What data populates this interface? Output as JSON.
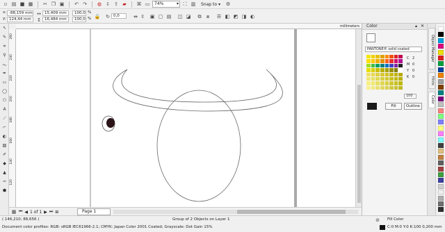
{
  "toolbar": {
    "zoom_value": "74%",
    "snap_label": "Snap to",
    "rotation_value": "0,0"
  },
  "propertybar": {
    "x_label": "x:",
    "x_value": "-88,159 mm",
    "y_label": "y:",
    "y_value": "124,44 mm",
    "width_value": "15,409 mm",
    "height_value": "16,484 mm",
    "scale_w": "100,0",
    "scale_h": "100,0",
    "scale_unit": "%"
  },
  "ruler": {
    "unit_label": "millimeters",
    "v_ticks": [
      "260",
      "240",
      "220",
      "200",
      "180",
      "160",
      "140",
      "120"
    ]
  },
  "page_nav": {
    "page_count": "1 of 1",
    "page_tab": "Page 1"
  },
  "status": {
    "coordinates": "( 146,210; 88,656 )",
    "selection_info": "Group of 2 Objects on Layer 1",
    "color_profiles": "Document color profiles: RGB: sRGB IEC61966-2.1; CMYK: Japan Color 2001 Coated; Grayscale: Dot Gain 15%",
    "fill_label": "Fill Color",
    "outline_info": "C:0 M:0 Y:0 K:100  0,200 mm"
  },
  "color_docker": {
    "title": "Color",
    "model": "PANTONE® solid coated",
    "values": [
      {
        "key": "C",
        "value": "2"
      },
      {
        "key": "M",
        "value": "0"
      },
      {
        "key": "Y",
        "value": "0"
      },
      {
        "key": "K",
        "value": "0"
      }
    ],
    "tint": "100",
    "fill_button": "Fill",
    "outline_button": "Outline",
    "grid_colors": [
      "#f5e600",
      "#f2d100",
      "#e8c000",
      "#e0a000",
      "#ff8c00",
      "#f05000",
      "#e02020",
      "#c00050",
      "#ffe000",
      "#ffc800",
      "#f0b000",
      "#e89000",
      "#ff6020",
      "#e83030",
      "#d0106a",
      "#b01090",
      "#a0e020",
      "#40c040",
      "#00a060",
      "#008080",
      "#0070c0",
      "#4040c0",
      "#8020a0",
      "#202020",
      "#e8e000",
      "#d8d000",
      "#c8c000",
      "#b8b000",
      "#a8a000",
      "#989000",
      "#888000",
      "#ffffff",
      "#f0e060",
      "#e8d850",
      "#e0d040",
      "#d8c830",
      "#d0c020",
      "#c8b810",
      "#c0b000",
      "#b8a800",
      "#f0e870",
      "#e8e060",
      "#e0d850",
      "#d8d040",
      "#d0c830",
      "#c8c020",
      "#c0b810",
      "#b8b000",
      "#f8f080",
      "#f0e870",
      "#e8e060",
      "#e0d850",
      "#d8d040",
      "#d0c830",
      "#c8c020",
      "#c0b810",
      "#f8f090",
      "#f0e880",
      "#e8e070",
      "#e0d860",
      "#d8d050",
      "#d0c840",
      "#c8c030",
      "#c0b820"
    ]
  },
  "docker_tabs": [
    "Object Manager",
    "Hints",
    "Color"
  ],
  "palette_colors": [
    "#ffffff",
    "#000000",
    "#00a0e0",
    "#e00080",
    "#f0e000",
    "#e02020",
    "#00a040",
    "#0040a0",
    "#f08000",
    "#a0a0a0",
    "#804000",
    "#008080",
    "#800080",
    "#c0c0c0",
    "#ff8080",
    "#80ff80",
    "#8080ff",
    "#ffff80",
    "#ff80ff",
    "#80ffff",
    "#404040",
    "#e0c080",
    "#c08040",
    "#606060",
    "#a04040",
    "#40a040",
    "#4040a0",
    "#d0d0d0",
    "#f0f0f0",
    "#b0b0b0",
    "#707070",
    "#303030"
  ]
}
